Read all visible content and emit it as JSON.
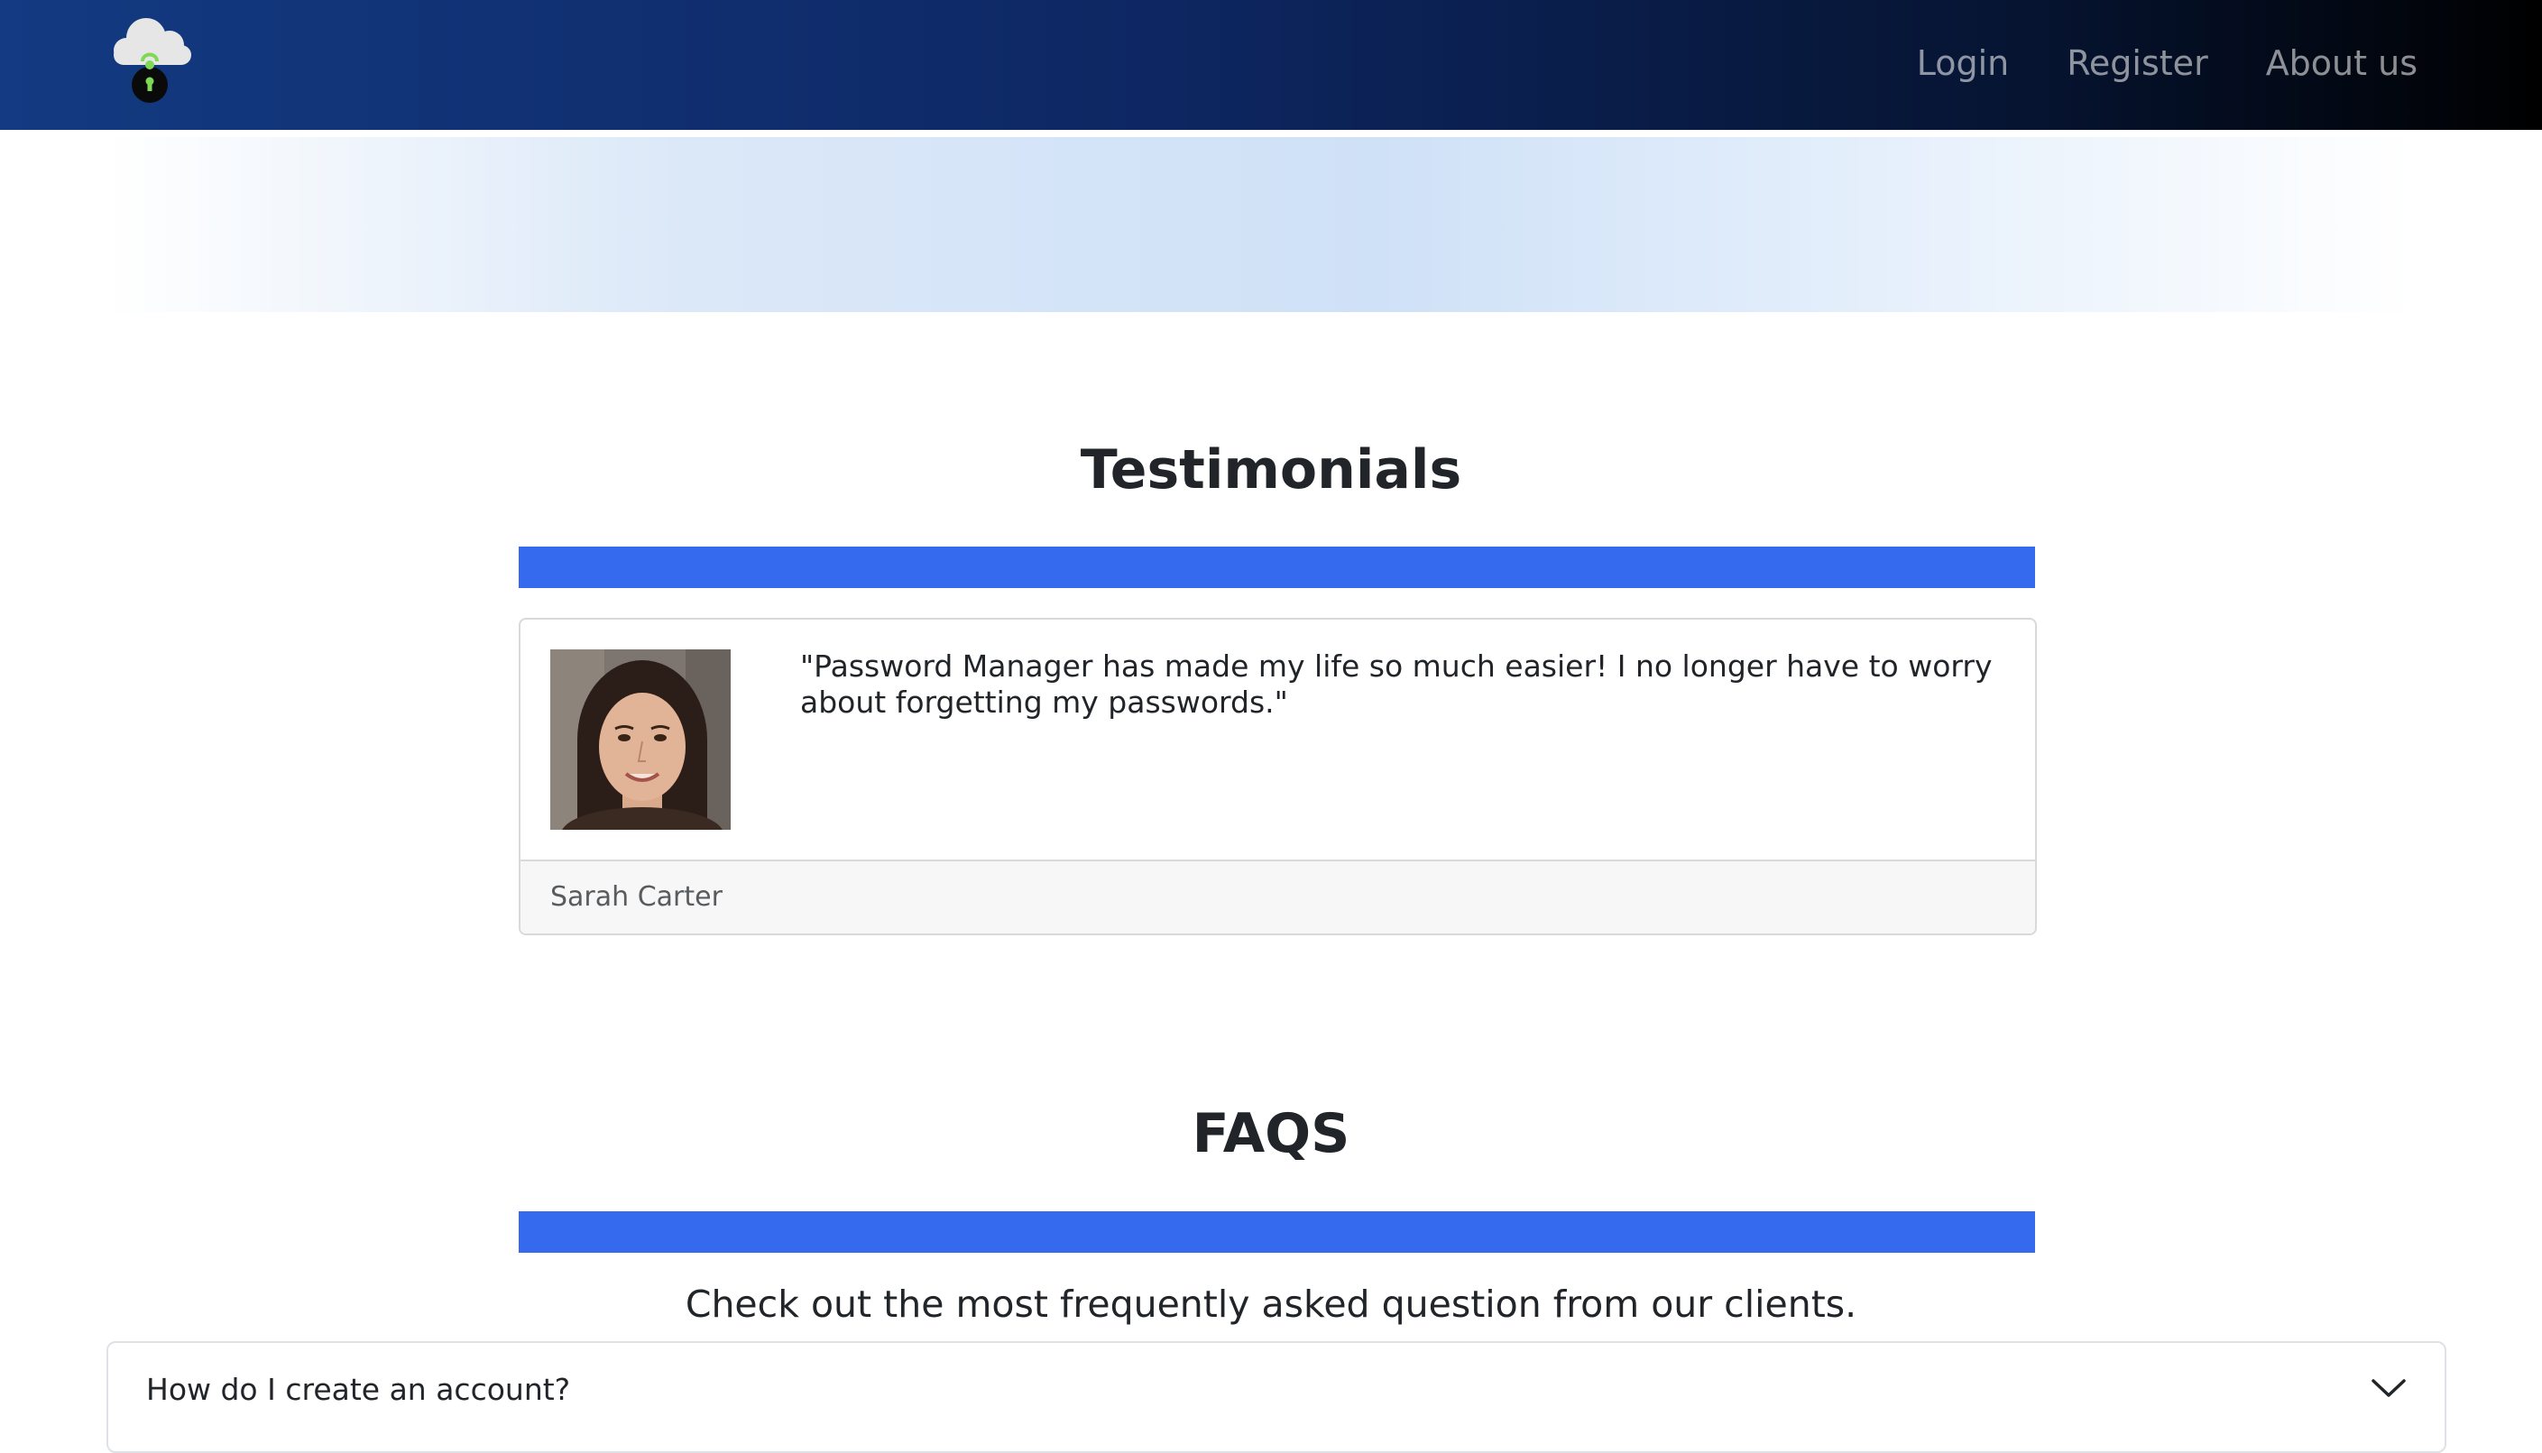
{
  "navbar": {
    "logo_icon": "cloud-lock-icon",
    "links": [
      {
        "label": "Login"
      },
      {
        "label": "Register"
      },
      {
        "label": "About us"
      }
    ],
    "gradient": [
      "#133a82",
      "#000000"
    ]
  },
  "testimonials": {
    "title": "Testimonials",
    "accent_color": "#356aee",
    "items": [
      {
        "quote": "\"Password Manager has made my life so much easier! I no longer have to worry about forgetting my passwords.\"",
        "author": "Sarah Carter",
        "avatar_icon": "user-photo"
      }
    ]
  },
  "faqs": {
    "title": "FAQS",
    "intro": "Check out the most frequently asked question from our clients.",
    "items": [
      {
        "question": "How do I create an account?",
        "expanded": false,
        "icon": "chevron-down-icon"
      }
    ]
  }
}
